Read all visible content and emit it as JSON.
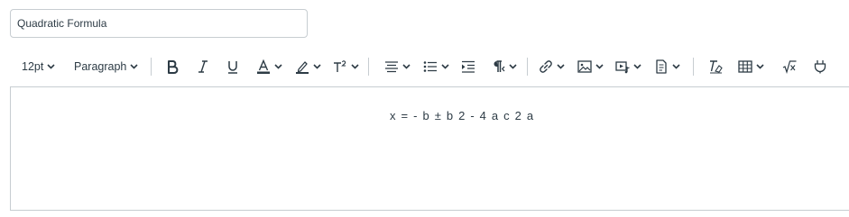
{
  "title_field": {
    "value": "Quadratic Formula"
  },
  "toolbar": {
    "font_size": "12pt",
    "block_format": "Paragraph",
    "icons": [
      "bold-icon",
      "italic-icon",
      "underline-icon",
      "text-color-icon",
      "highlight-color-icon",
      "superscript-icon",
      "align-icon",
      "bulleted-list-icon",
      "indent-icon",
      "text-direction-icon",
      "link-icon",
      "image-icon",
      "media-icon",
      "document-icon",
      "clear-formatting-icon",
      "table-icon",
      "equation-icon",
      "apps-icon"
    ]
  },
  "editor": {
    "formula_text": "x = - b ± b 2 - 4 a c 2 a"
  },
  "colors": {
    "border": "#c7cdd1",
    "text": "#2d3b45"
  }
}
